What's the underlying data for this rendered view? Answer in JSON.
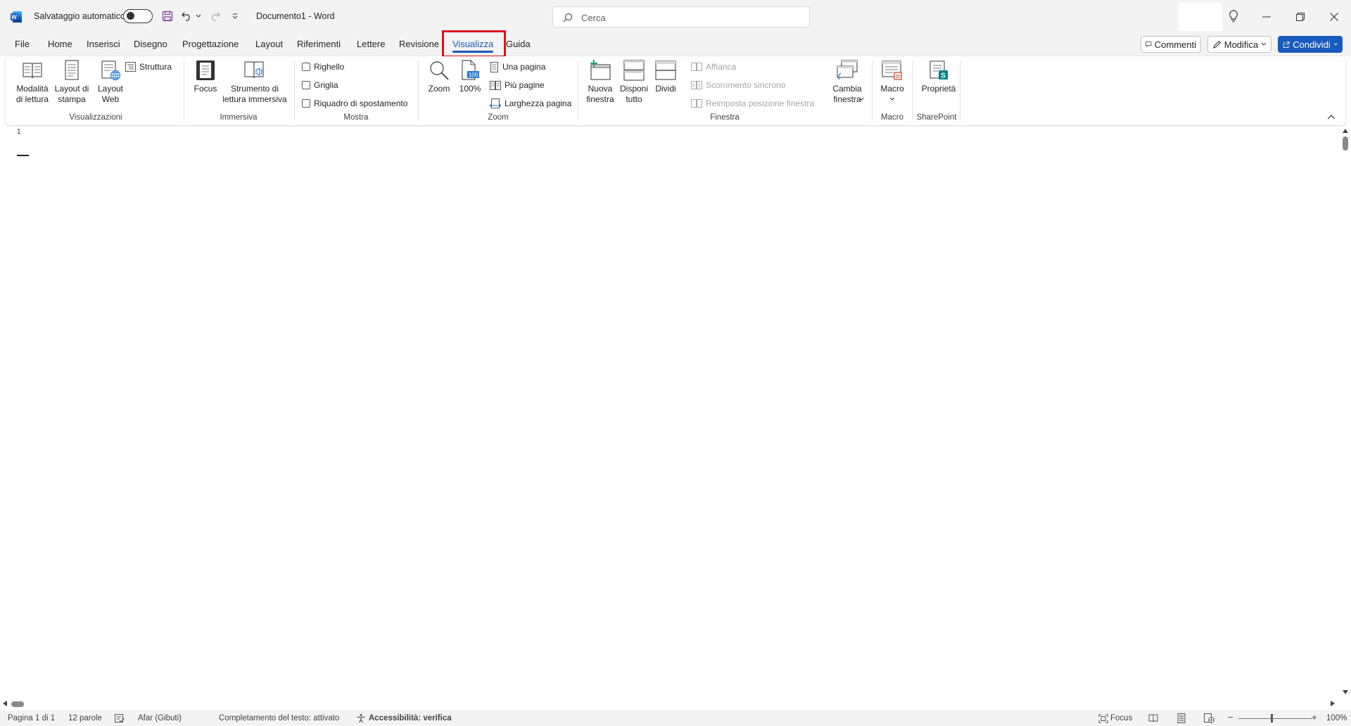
{
  "titlebar": {
    "autosave_label": "Salvataggio automatico",
    "doc_title": "Documento1  -  Word",
    "search_placeholder": "Cerca"
  },
  "tabs": [
    {
      "label": "File"
    },
    {
      "label": "Home"
    },
    {
      "label": "Inserisci"
    },
    {
      "label": "Disegno"
    },
    {
      "label": "Progettazione"
    },
    {
      "label": "Layout"
    },
    {
      "label": "Riferimenti"
    },
    {
      "label": "Lettere"
    },
    {
      "label": "Revisione"
    },
    {
      "label": "Visualizza",
      "active": true
    },
    {
      "label": "Guida"
    }
  ],
  "top_actions": {
    "comments": "Commenti",
    "edit": "Modifica",
    "share": "Condividi"
  },
  "ribbon": {
    "visualizzazioni": {
      "label": "Visualizzazioni",
      "reading_mode": "Modalità\ndi lettura",
      "print_layout": "Layout di\nstampa",
      "web_layout": "Layout\nWeb",
      "outline": "Struttura"
    },
    "immersiva": {
      "label": "Immersiva",
      "focus": "Focus",
      "immersive_reader": "Strumento di\nlettura immersiva"
    },
    "mostra": {
      "label": "Mostra",
      "ruler": "Righello",
      "grid": "Griglia",
      "nav_pane": "Riquadro di spostamento"
    },
    "zoom": {
      "label": "Zoom",
      "zoom": "Zoom",
      "hundred": "100%",
      "one_page": "Una pagina",
      "multi_page": "Più pagine",
      "page_width": "Larghezza pagina"
    },
    "finestra": {
      "label": "Finestra",
      "new_window": "Nuova\nfinestra",
      "arrange_all": "Disponi\ntutto",
      "split": "Dividi",
      "side_by_side": "Affianca",
      "sync_scroll": "Scorrimento sincrono",
      "reset_position": "Reimposta posizione finestra",
      "switch_window": "Cambia\nfinestra"
    },
    "macro": {
      "label": "Macro",
      "macro": "Macro"
    },
    "sharepoint": {
      "label": "SharePoint",
      "properties": "Proprietà"
    }
  },
  "document": {
    "page_number": "1"
  },
  "statusbar": {
    "page": "Pagina 1 di 1",
    "words": "12 parole",
    "language": "Afar (Gibuti)",
    "text_prediction": "Completamento del testo: attivato",
    "accessibility": "Accessibilità: verifica",
    "focus": "Focus",
    "zoom_level": "100%"
  },
  "colors": {
    "accent": "#185abd",
    "highlight": "#e0111b",
    "chrome_bg": "#f3f3f3"
  }
}
